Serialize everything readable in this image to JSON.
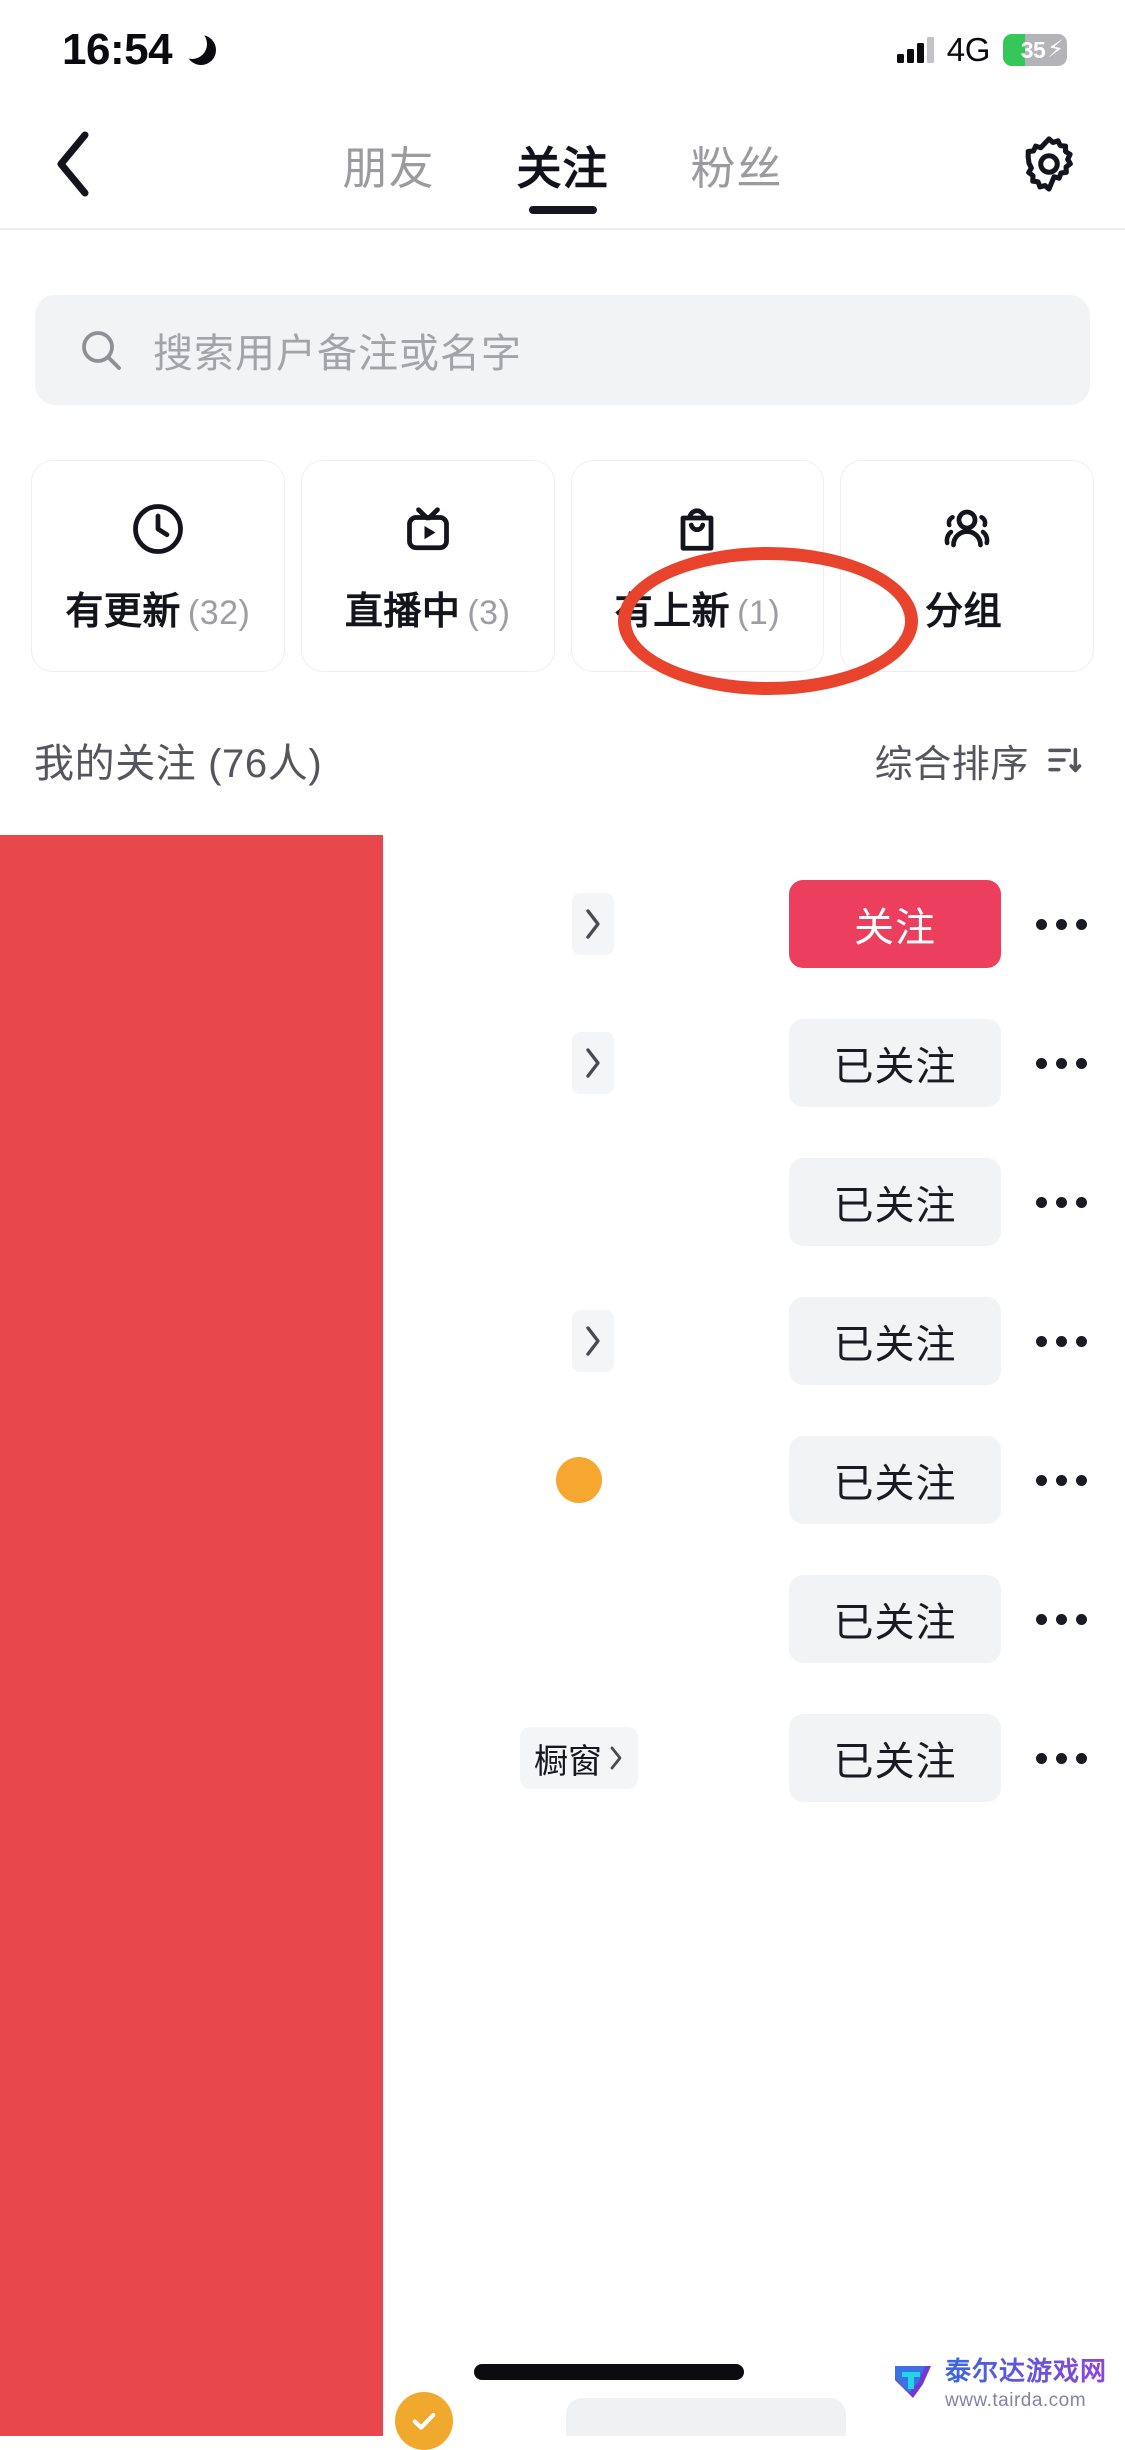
{
  "status_bar": {
    "time": "16:54",
    "moon_icon": "crescent-moon-icon",
    "signal_icon": "cellular-signal-icon",
    "network": "4G",
    "battery_level": "35",
    "battery_charging_icon": "lightning-bolt-icon",
    "battery_fill_color": "#36c759"
  },
  "nav": {
    "back_icon": "chevron-left-icon",
    "settings_icon": "gear-icon",
    "tabs": [
      {
        "label": "朋友",
        "active": false
      },
      {
        "label": "关注",
        "active": true
      },
      {
        "label": "粉丝",
        "active": false
      }
    ]
  },
  "search": {
    "icon": "search-icon",
    "placeholder": "搜索用户备注或名字",
    "value": ""
  },
  "filters": [
    {
      "icon": "clock-icon",
      "label": "有更新",
      "count": "(32)"
    },
    {
      "icon": "live-tv-icon",
      "label": "直播中",
      "count": "(3)"
    },
    {
      "icon": "shopping-bag-icon",
      "label": "有上新",
      "count": "(1)"
    },
    {
      "icon": "people-group-icon",
      "label": "分组",
      "count": ""
    }
  ],
  "section": {
    "title": "我的关注 (76人)",
    "sort_label": "综合排序",
    "sort_icon": "sort-icon"
  },
  "list": {
    "chevron_icon": "chevron-right-icon",
    "more_icon": "ellipsis-icon",
    "rows": [
      {
        "action": "关注",
        "state": "follow",
        "accessory": "chevron"
      },
      {
        "action": "已关注",
        "state": "following",
        "accessory": "chevron"
      },
      {
        "action": "已关注",
        "state": "following",
        "accessory": "none"
      },
      {
        "action": "已关注",
        "state": "following",
        "accessory": "chevron"
      },
      {
        "action": "已关注",
        "state": "following",
        "accessory": "badge"
      },
      {
        "action": "已关注",
        "state": "following",
        "accessory": "none"
      },
      {
        "action": "已关注",
        "state": "following",
        "accessory": "tag",
        "tag_label": "橱窗"
      }
    ]
  },
  "colors": {
    "follow_button": "#ec3f5d",
    "following_button": "#f2f3f5",
    "redaction_overlay": "#e8474b",
    "annotation_ring": "#e8432d",
    "tab_indicator": "#161622"
  },
  "annotation": {
    "shape": "ellipse",
    "target": "关注"
  },
  "redaction": {
    "shape": "rectangle",
    "color": "#e8474b"
  },
  "bottom": {
    "home_indicator": "home-indicator",
    "check_badge_icon": "check-circle-icon"
  },
  "watermark": {
    "title": "泰尔达游戏网",
    "url": "www.tairda.com",
    "logo_icon": "t-shield-logo-icon"
  }
}
